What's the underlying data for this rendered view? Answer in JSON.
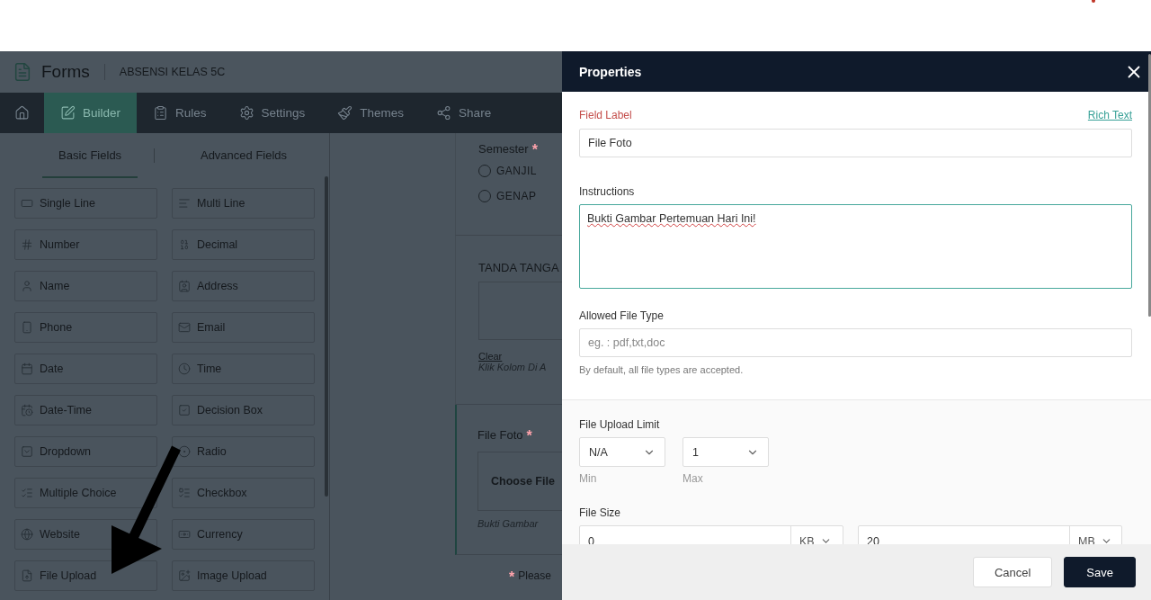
{
  "app": {
    "title": "Forms",
    "form_name": "ABSENSI KELAS 5C",
    "nav": [
      {
        "selected": false
      },
      {
        "label": "Builder",
        "selected": true
      },
      {
        "label": "Rules",
        "selected": false
      },
      {
        "label": "Settings",
        "selected": false
      },
      {
        "label": "Themes",
        "selected": false
      },
      {
        "label": "Share",
        "selected": false
      }
    ],
    "field_tabs": [
      {
        "label": "Basic Fields",
        "selected": true
      },
      {
        "label": "Advanced Fields",
        "selected": false
      }
    ],
    "fields": [
      "Single Line",
      "Multi Line",
      "Number",
      "Decimal",
      "Name",
      "Address",
      "Phone",
      "Email",
      "Date",
      "Time",
      "Date-Time",
      "Decision Box",
      "Dropdown",
      "Radio",
      "Multiple Choice",
      "Checkbox",
      "Website",
      "Currency",
      "File Upload",
      "Image Upload"
    ]
  },
  "form_preview": {
    "semester": {
      "label": "Semester",
      "required_mark": "*",
      "options": [
        {
          "label": "GANJIL",
          "selected": false
        },
        {
          "label": "GENAP",
          "selected": false
        }
      ]
    },
    "signature": {
      "label": "TANDA TANGA",
      "clear": "Clear",
      "hint": "Klik Kolom Di A"
    },
    "file_field": {
      "label": "File Foto",
      "required_mark": "*",
      "button": "Choose File",
      "hint": "Bukti Gambar"
    },
    "footer_note": {
      "mark": "*",
      "text": "Please"
    }
  },
  "properties": {
    "title": "Properties",
    "field_label": {
      "label": "Field Label",
      "value": "File Foto",
      "link": "Rich Text"
    },
    "instructions": {
      "label": "Instructions",
      "value": "Bukti Gambar Pertemuan Hari Ini!"
    },
    "allowed_file_type": {
      "label": "Allowed File Type",
      "placeholder": "eg. : pdf,txt,doc",
      "help": "By default, all file types are accepted."
    },
    "upload_limit": {
      "label": "File Upload Limit",
      "min": {
        "value": "N/A",
        "caption": "Min"
      },
      "max": {
        "value": "1",
        "caption": "Max"
      }
    },
    "file_size": {
      "label": "File Size",
      "min": {
        "value": "0",
        "unit": "KB"
      },
      "max": {
        "value": "20",
        "unit": "MB"
      }
    },
    "buttons": [
      {
        "label": "Cancel",
        "kind": "secondary"
      },
      {
        "label": "Save",
        "kind": "primary"
      }
    ]
  }
}
